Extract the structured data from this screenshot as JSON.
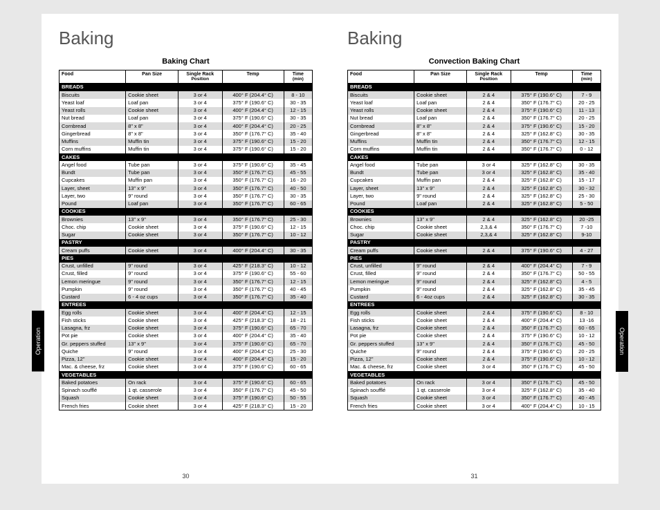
{
  "sideTab": "Operation",
  "left": {
    "heading": "Baking",
    "chartTitle": "Baking Chart",
    "pageNum": "30",
    "headers": {
      "food": "Food",
      "pan": "Pan Size",
      "rack1": "Single Rack",
      "rack2": "Position",
      "temp": "Temp",
      "time1": "Time",
      "time2": "(min)"
    },
    "sections": [
      {
        "name": "BREADS",
        "rows": [
          {
            "food": "Biscuits",
            "pan": "Cookie sheet",
            "rack": "3 or 4",
            "temp": "400° F (204.4° C)",
            "time": "8 - 10",
            "shade": true
          },
          {
            "food": "Yeast loaf",
            "pan": "Loaf pan",
            "rack": "3 or 4",
            "temp": "375° F (190.6° C)",
            "time": "30 - 35"
          },
          {
            "food": "Yeast rolls",
            "pan": "Cookie sheet",
            "rack": "3 or 4",
            "temp": "400° F (204.4° C)",
            "time": "12 - 15",
            "shade": true
          },
          {
            "food": "Nut bread",
            "pan": "Loaf pan",
            "rack": "3 or 4",
            "temp": "375° F (190.6° C)",
            "time": "30 - 35"
          },
          {
            "food": "Cornbread",
            "pan": "8\" x 8\"",
            "rack": "3 or 4",
            "temp": "400° F (204.4° C)",
            "time": "20 - 25",
            "shade": true
          },
          {
            "food": "Gingerbread",
            "pan": "8\" x 8\"",
            "rack": "3 or 4",
            "temp": "350° F (176.7° C)",
            "time": "35 - 40"
          },
          {
            "food": "Muffins",
            "pan": "Muffin tin",
            "rack": "3 or 4",
            "temp": "375° F (190.6° C)",
            "time": "15 - 20",
            "shade": true
          },
          {
            "food": "Corn muffins",
            "pan": "Muffin tin",
            "rack": "3 or 4",
            "temp": "375° F (190.6° C)",
            "time": "15 - 20"
          }
        ]
      },
      {
        "name": "CAKES",
        "rows": [
          {
            "food": "Angel food",
            "pan": "Tube pan",
            "rack": "3 or 4",
            "temp": "375° F (190.6° C)",
            "time": "35 - 45"
          },
          {
            "food": "Bundt",
            "pan": "Tube pan",
            "rack": "3 or 4",
            "temp": "350° F (176.7° C)",
            "time": "45 - 55",
            "shade": true
          },
          {
            "food": "Cupcakes",
            "pan": "Muffin pan",
            "rack": "3 or 4",
            "temp": "350° F (176.7° C)",
            "time": "16 - 20"
          },
          {
            "food": "Layer, sheet",
            "pan": "13\" x 9\"",
            "rack": "3 or 4",
            "temp": "350° F (176.7° C)",
            "time": "40 - 50",
            "shade": true
          },
          {
            "food": "Layer, two",
            "pan": "9\" round",
            "rack": "3 or 4",
            "temp": "350° F (176.7° C)",
            "time": "30 - 35"
          },
          {
            "food": "Pound",
            "pan": "Loaf pan",
            "rack": "3 or 4",
            "temp": "350° F (176.7° C)",
            "time": "60 - 65",
            "shade": true
          }
        ]
      },
      {
        "name": "COOKIES",
        "rows": [
          {
            "food": "Brownies",
            "pan": "13\" x 9\"",
            "rack": "3 or 4",
            "temp": "350° F (176.7° C)",
            "time": "25 - 30",
            "shade": true
          },
          {
            "food": "Choc. chip",
            "pan": "Cookie sheet",
            "rack": "3 or 4",
            "temp": "375° F (190.6° C)",
            "time": "12 - 15"
          },
          {
            "food": "Sugar",
            "pan": "Cookie sheet",
            "rack": "3 or 4",
            "temp": "350° F (176.7° C)",
            "time": "10 - 12",
            "shade": true
          }
        ]
      },
      {
        "name": "PASTRY",
        "rows": [
          {
            "food": "Cream puffs",
            "pan": "Cookie sheet",
            "rack": "3 or 4",
            "temp": "400° F (204.4° C)",
            "time": "30 - 35",
            "shade": true
          }
        ]
      },
      {
        "name": "PIES",
        "rows": [
          {
            "food": "Crust, unfilled",
            "pan": "9\" round",
            "rack": "3 or 4",
            "temp": "425° F (218.3° C)",
            "time": "10 - 12",
            "shade": true
          },
          {
            "food": "Crust, filled",
            "pan": "9\" round",
            "rack": "3 or 4",
            "temp": "375° F (190.6° C)",
            "time": "55 - 60"
          },
          {
            "food": "Lemon meringue",
            "pan": "9\" round",
            "rack": "3 or 4",
            "temp": "350° F (176.7° C)",
            "time": "12 - 15",
            "shade": true
          },
          {
            "food": "Pumpkin",
            "pan": "9\" round",
            "rack": "3 or 4",
            "temp": "350° F (176.7° C)",
            "time": "40 - 45"
          },
          {
            "food": "Custard",
            "pan": "6 - 4 oz cups",
            "rack": "3 or 4",
            "temp": "350° F (176.7° C)",
            "time": "35 - 40",
            "shade": true
          }
        ]
      },
      {
        "name": "ENTREES",
        "rows": [
          {
            "food": "Egg rolls",
            "pan": "Cookie sheet",
            "rack": "3 or 4",
            "temp": "400° F (204.4° C)",
            "time": "12 - 15",
            "shade": true
          },
          {
            "food": "Fish sticks",
            "pan": "Cookie sheet",
            "rack": "3 or 4",
            "temp": "425° F (218.3° C)",
            "time": "18 - 21"
          },
          {
            "food": "Lasagna, frz",
            "pan": "Cookie sheet",
            "rack": "3 or 4",
            "temp": "375° F (190.6° C)",
            "time": "65 - 70",
            "shade": true
          },
          {
            "food": "Pot pie",
            "pan": "Cookie sheet",
            "rack": "3 or 4",
            "temp": "400° F (204.4° C)",
            "time": "35 - 40"
          },
          {
            "food": "Gr. peppers stuffed",
            "pan": "13\" x 9\"",
            "rack": "3 or 4",
            "temp": "375° F (190.6° C)",
            "time": "65 - 70",
            "shade": true
          },
          {
            "food": "Quiche",
            "pan": "9\" round",
            "rack": "3 or 4",
            "temp": "400° F (204.4° C)",
            "time": "25 - 30"
          },
          {
            "food": "Pizza, 12\"",
            "pan": "Cookie sheet",
            "rack": "3 or 4",
            "temp": "400° F (204.4° C)",
            "time": "15 - 20",
            "shade": true
          },
          {
            "food": "Mac. & cheese, frz",
            "pan": "Cookie sheet",
            "rack": "3 or 4",
            "temp": "375° F (190.6° C)",
            "time": "60 - 65"
          }
        ]
      },
      {
        "name": "VEGETABLES",
        "rows": [
          {
            "food": "Baked potatoes",
            "pan": "On rack",
            "rack": "3 or 4",
            "temp": "375° F (190.6° C)",
            "time": "60 - 65",
            "shade": true
          },
          {
            "food": "Spinach soufflé",
            "pan": "1 qt. casserole",
            "rack": "3 or 4",
            "temp": "350° F (176.7° C)",
            "time": "45 - 50"
          },
          {
            "food": "Squash",
            "pan": "Cookie sheet",
            "rack": "3 or 4",
            "temp": "375° F (190.6° C)",
            "time": "50 - 55",
            "shade": true
          },
          {
            "food": "French fries",
            "pan": "Cookie sheet",
            "rack": "3 or 4",
            "temp": "425° F (218.3° C)",
            "time": "15 - 20"
          }
        ]
      }
    ]
  },
  "right": {
    "heading": "Baking",
    "chartTitle": "Convection Baking Chart",
    "pageNum": "31",
    "headers": {
      "food": "Food",
      "pan": "Pan Size",
      "rack1": "Single Rack",
      "rack2": "Position",
      "temp": "Temp",
      "time1": "Time",
      "time2": "(min)"
    },
    "sections": [
      {
        "name": "BREADS",
        "rows": [
          {
            "food": "Biscuits",
            "pan": "Cookie sheet",
            "rack": "2 & 4",
            "temp": "375° F (190.6° C)",
            "time": "7 - 9",
            "shade": true
          },
          {
            "food": "Yeast loaf",
            "pan": "Loaf pan",
            "rack": "2 & 4",
            "temp": "350° F (176.7° C)",
            "time": "20 - 25"
          },
          {
            "food": "Yeast rolls",
            "pan": "Cookie sheet",
            "rack": "2 & 4",
            "temp": "375° F (190.6° C)",
            "time": "11 - 13",
            "shade": true
          },
          {
            "food": "Nut bread",
            "pan": "Loaf pan",
            "rack": "2 & 4",
            "temp": "350° F (176.7° C)",
            "time": "20 - 25"
          },
          {
            "food": "Cornbread",
            "pan": "8\" x 8\"",
            "rack": "2 & 4",
            "temp": "375° F (190.6° C)",
            "time": "15 - 20",
            "shade": true
          },
          {
            "food": "Gingerbread",
            "pan": "8\" x 8\"",
            "rack": "2 & 4",
            "temp": "325° F (162.8° C)",
            "time": "30 - 35"
          },
          {
            "food": "Muffins",
            "pan": "Muffin tin",
            "rack": "2 & 4",
            "temp": "350° F (176.7° C)",
            "time": "12 - 15",
            "shade": true
          },
          {
            "food": "Corn muffins",
            "pan": "Muffin tin",
            "rack": "2 & 4",
            "temp": "350° F (176.7° C)",
            "time": "0 - 12"
          }
        ]
      },
      {
        "name": "CAKES",
        "rows": [
          {
            "food": "Angel food",
            "pan": "Tube pan",
            "rack": "3 or 4",
            "temp": "325° F (162.8° C)",
            "time": "30 - 35"
          },
          {
            "food": "Bundt",
            "pan": "Tube pan",
            "rack": "3 or 4",
            "temp": "325° F (162.8° C)",
            "time": "35 - 40",
            "shade": true
          },
          {
            "food": "Cupcakes",
            "pan": "Muffin pan",
            "rack": "2 & 4",
            "temp": "325° F (162.8° C)",
            "time": "15 - 17"
          },
          {
            "food": "Layer, sheet",
            "pan": "13\" x 9\"",
            "rack": "2 & 4",
            "temp": "325° F (162.8° C)",
            "time": "30 - 32",
            "shade": true
          },
          {
            "food": "Layer, two",
            "pan": "9\" round",
            "rack": "2 & 4",
            "temp": "325° F (162.8° C)",
            "time": "25 - 30"
          },
          {
            "food": "Pound",
            "pan": "Loaf pan",
            "rack": "2 & 4",
            "temp": "325° F (162.8° C)",
            "time": "5 - 50",
            "shade": true
          }
        ]
      },
      {
        "name": "COOKIES",
        "rows": [
          {
            "food": "Brownies",
            "pan": "13\" x 9\"",
            "rack": "2 & 4",
            "temp": "325° F (162.8° C)",
            "time": "20 -25",
            "shade": true
          },
          {
            "food": "Choc. chip",
            "pan": "Cookie sheet",
            "rack": "2,3,& 4",
            "temp": "350° F (176.7° C)",
            "time": "7 -10"
          },
          {
            "food": "Sugar",
            "pan": "Cookie sheet",
            "rack": "2,3,& 4",
            "temp": "325° F (162.8° C)",
            "time": "9-10",
            "shade": true
          }
        ]
      },
      {
        "name": "PASTRY",
        "rows": [
          {
            "food": "Cream puffs",
            "pan": "Cookie sheet",
            "rack": "2 & 4",
            "temp": "375° F (190.6° C)",
            "time": "4 - 27",
            "shade": true
          }
        ]
      },
      {
        "name": "PIES",
        "rows": [
          {
            "food": "Crust, unfilled",
            "pan": "9\" round",
            "rack": "2 & 4",
            "temp": "400° F (204.4° C)",
            "time": "7 - 9",
            "shade": true
          },
          {
            "food": "Crust, filled",
            "pan": "9\" round",
            "rack": "2 & 4",
            "temp": "350° F (176.7° C)",
            "time": "50 - 55"
          },
          {
            "food": "Lemon meringue",
            "pan": "9\" round",
            "rack": "2 & 4",
            "temp": "325° F (162.8° C)",
            "time": "4 - 5",
            "shade": true
          },
          {
            "food": "Pumpkin",
            "pan": "9\" round",
            "rack": "2 & 4",
            "temp": "325° F (162.8° C)",
            "time": "35 - 45"
          },
          {
            "food": "Custard",
            "pan": "6 - 4oz cups",
            "rack": "2 & 4",
            "temp": "325° F (162.8° C)",
            "time": "30 - 35",
            "shade": true
          }
        ]
      },
      {
        "name": "ENTREES",
        "rows": [
          {
            "food": "Egg rolls",
            "pan": "Cookie sheet",
            "rack": "2 & 4",
            "temp": "375° F (190.6° C)",
            "time": "8 - 10",
            "shade": true
          },
          {
            "food": "Fish sticks",
            "pan": "Cookie sheet",
            "rack": "2 & 4",
            "temp": "400° F (204.4° C)",
            "time": "13 -16"
          },
          {
            "food": "Lasagna, frz",
            "pan": "Cookie sheet",
            "rack": "2 & 4",
            "temp": "350° F (176.7° C)",
            "time": "60 - 65",
            "shade": true
          },
          {
            "food": "Pot pie",
            "pan": "Cookie sheet",
            "rack": "2 & 4",
            "temp": "375° F (190.6° C)",
            "time": "10 - 12"
          },
          {
            "food": "Gr. peppers stuffed",
            "pan": "13\" x 9\"",
            "rack": "2 & 4",
            "temp": "350° F (176.7° C)",
            "time": "45 - 50",
            "shade": true
          },
          {
            "food": "Quiche",
            "pan": "9\" round",
            "rack": "2 & 4",
            "temp": "375° F (190.6° C)",
            "time": "20 - 25"
          },
          {
            "food": "Pizza, 12\"",
            "pan": "Cookie sheet",
            "rack": "2 & 4",
            "temp": "375° F (190.6° C)",
            "time": "10 - 12",
            "shade": true
          },
          {
            "food": "Mac. & cheese, frz",
            "pan": "Cookie sheet",
            "rack": "3 or 4",
            "temp": "350° F (176.7° C)",
            "time": "45 - 50"
          }
        ]
      },
      {
        "name": "VEGETABLES",
        "rows": [
          {
            "food": "Baked potatoes",
            "pan": "On rack",
            "rack": "3 or 4",
            "temp": "350° F (176.7° C)",
            "time": "45 - 50",
            "shade": true
          },
          {
            "food": "Spinach soufflé",
            "pan": "1 qt. casserole",
            "rack": "3 or 4",
            "temp": "325° F (162.8° C)",
            "time": "35 - 40"
          },
          {
            "food": "Squash",
            "pan": "Cookie sheet",
            "rack": "3 or 4",
            "temp": "350° F (176.7° C)",
            "time": "40 - 45",
            "shade": true
          },
          {
            "food": "French fries",
            "pan": "Cookie sheet",
            "rack": "3 or 4",
            "temp": "400° F (204.4° C)",
            "time": "10 - 15"
          }
        ]
      }
    ]
  }
}
